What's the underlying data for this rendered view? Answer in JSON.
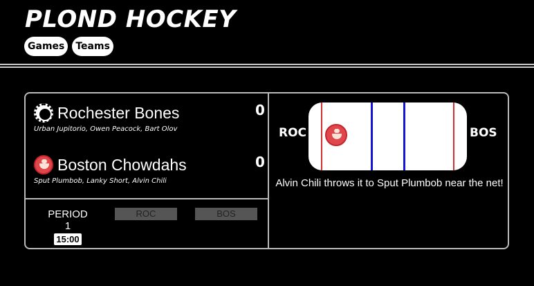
{
  "app": {
    "title": "PLOND HOCKEY",
    "nav": [
      "Games",
      "Teams"
    ]
  },
  "game": {
    "home": {
      "name": "Rochester Bones",
      "abbr": "ROC",
      "players": "Urban Jupitorio, Owen Peacock, Bart Olov",
      "score": "0",
      "logo_icon": "bones-logo-icon"
    },
    "away": {
      "name": "Boston Chowdahs",
      "abbr": "BOS",
      "players": "Sput Plumbob, Lanky Short, Alvin Chili",
      "score": "0",
      "logo_icon": "chowder-logo-icon"
    },
    "period_label": "PERIOD 1",
    "clock": "15:00",
    "buttons": [
      "ROC",
      "BOS"
    ],
    "rink": {
      "left_label": "ROC",
      "right_label": "BOS",
      "bracket_left": "[",
      "bracket_right": "]"
    },
    "play_message": "Alvin Chili throws it to Sput Plumbob near the net!"
  },
  "colors": {
    "background": "#000000",
    "accent_red": "#d32f2f",
    "accent_blue": "#1515d6",
    "button_gray": "#555555"
  }
}
